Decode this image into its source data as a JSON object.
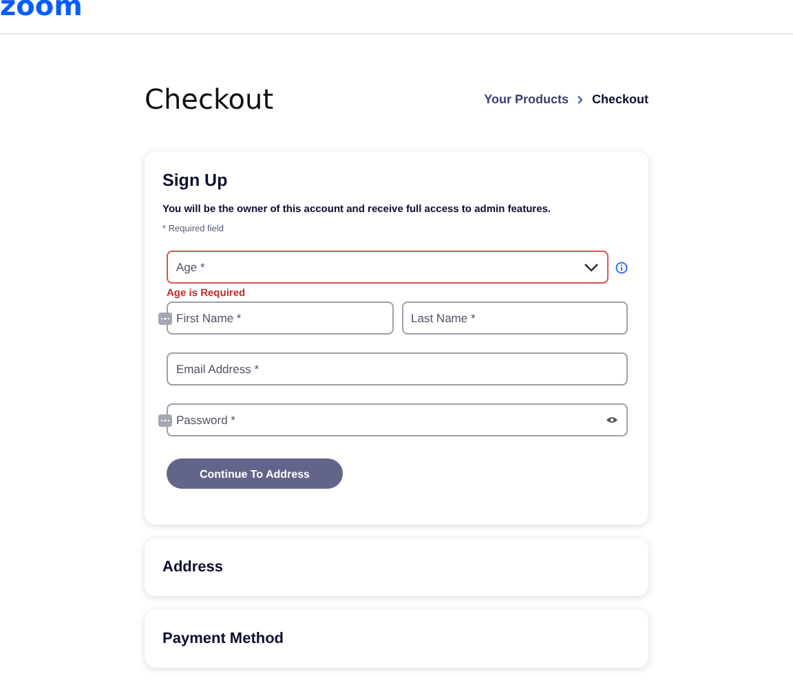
{
  "logo": "zoom",
  "title": "Checkout",
  "breadcrumb": [
    {
      "label": "Your Products",
      "selected": false
    },
    {
      "label": "Checkout",
      "selected": true
    }
  ],
  "signup": {
    "title": "Sign Up",
    "description": "You will be the owner of this account and receive full access to admin features.",
    "note": "* Required field",
    "rows": [
      {
        "fields": [
          {
            "kind": "select",
            "placeholder": "Age *",
            "invalid": true,
            "error": "Age is Required",
            "autofill": false
          }
        ]
      },
      {
        "fields": [
          {
            "kind": "text",
            "placeholder": "First Name *",
            "invalid": false,
            "autofill": true
          },
          {
            "kind": "text",
            "placeholder": "Last Name *",
            "invalid": false,
            "autofill": false
          }
        ]
      },
      {
        "fields": [
          {
            "kind": "text",
            "placeholder": "Email Address *",
            "invalid": false,
            "autofill": false
          }
        ]
      },
      {
        "fields": [
          {
            "kind": "password",
            "placeholder": "Password *",
            "invalid": false,
            "autofill": true
          }
        ]
      }
    ],
    "button": "Continue To Address"
  },
  "sections": [
    "Address",
    "Payment Method"
  ]
}
